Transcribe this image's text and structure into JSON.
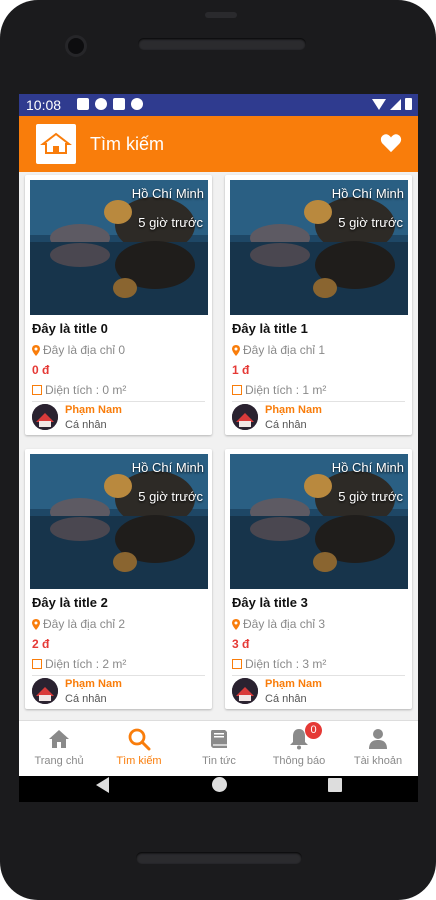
{
  "status_bar": {
    "time": "10:08"
  },
  "app_bar": {
    "title": "Tìm kiếm",
    "logo_icon": "house-logo",
    "favorite_icon": "heart-icon"
  },
  "colors": {
    "accent": "#f97d0b",
    "status_bar": "#2f3b8f",
    "price": "#e53935"
  },
  "listings": [
    {
      "city": "Hồ Chí Minh",
      "time_ago": "5 giờ trước",
      "title": "Đây là title 0",
      "address": "Đây là địa chỉ 0",
      "price": "0 đ",
      "area": "Diện tích : 0 m²",
      "owner": "Phạm Nam",
      "role": "Cá nhân"
    },
    {
      "city": "Hồ Chí Minh",
      "time_ago": "5 giờ trước",
      "title": "Đây là title 1",
      "address": "Đây là địa chỉ 1",
      "price": "1 đ",
      "area": "Diện tích : 1 m²",
      "owner": "Phạm Nam",
      "role": "Cá nhân"
    },
    {
      "city": "Hồ Chí Minh",
      "time_ago": "5 giờ trước",
      "title": "Đây là title 2",
      "address": "Đây là địa chỉ 2",
      "price": "2 đ",
      "area": "Diện tích : 2 m²",
      "owner": "Phạm Nam",
      "role": "Cá nhân"
    },
    {
      "city": "Hồ Chí Minh",
      "time_ago": "5 giờ trước",
      "title": "Đây là title 3",
      "address": "Đây là địa chỉ 3",
      "price": "3 đ",
      "area": "Diện tích : 3 m²",
      "owner": "Phạm Nam",
      "role": "Cá nhân"
    }
  ],
  "bottom_nav": {
    "items": [
      {
        "label": "Trang chủ",
        "icon": "home-icon"
      },
      {
        "label": "Tìm kiếm",
        "icon": "search-icon",
        "active": true
      },
      {
        "label": "Tin tức",
        "icon": "book-icon"
      },
      {
        "label": "Thông báo",
        "icon": "bell-icon",
        "badge": "0"
      },
      {
        "label": "Tài khoản",
        "icon": "person-icon"
      }
    ]
  }
}
